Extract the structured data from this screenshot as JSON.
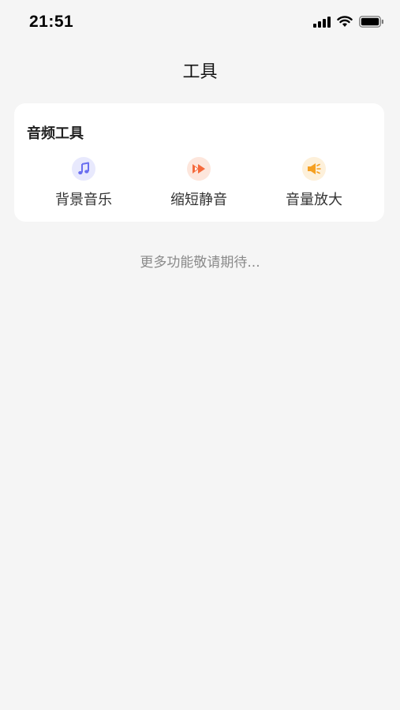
{
  "status_bar": {
    "time": "21:51",
    "icons": [
      "cellular-signal-icon",
      "wifi-icon",
      "battery-icon"
    ]
  },
  "header": {
    "title": "工具"
  },
  "audio_tools": {
    "section_title": "音频工具",
    "items": [
      {
        "label": "背景音乐",
        "icon": "music-note-icon",
        "color": "#6a6ff0",
        "bg": "#e8e9fd"
      },
      {
        "label": "缩短静音",
        "icon": "fast-forward-icon",
        "color": "#f56a3c",
        "bg": "#fde6dc"
      },
      {
        "label": "音量放大",
        "icon": "speaker-icon",
        "color": "#f5a021",
        "bg": "#fdf0da"
      }
    ]
  },
  "footer_note": "更多功能敬请期待..."
}
